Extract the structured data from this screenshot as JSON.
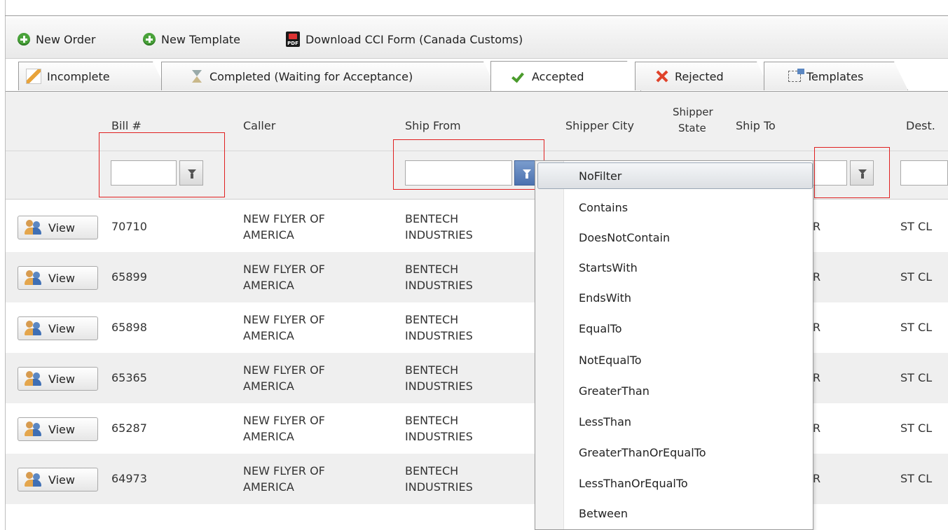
{
  "toolbar": {
    "new_order": "New Order",
    "new_template": "New Template",
    "download_cci": "Download CCI Form (Canada Customs)"
  },
  "tabs": [
    {
      "label": "Incomplete",
      "icon": "pencil-icon"
    },
    {
      "label": "Completed (Waiting for Acceptance)",
      "icon": "hourglass-icon"
    },
    {
      "label": "Accepted",
      "icon": "checkmark-icon",
      "active": true
    },
    {
      "label": "Rejected",
      "icon": "x-icon"
    },
    {
      "label": "Templates",
      "icon": "templates-icon"
    }
  ],
  "columns": {
    "bill": "Bill #",
    "caller": "Caller",
    "ship_from": "Ship From",
    "shipper_city": "Shipper City",
    "shipper_state_1": "Shipper",
    "shipper_state_2": "State",
    "ship_to": "Ship To",
    "dest": "Dest."
  },
  "rows": [
    {
      "view": "View",
      "bill": "70710",
      "caller_1": "NEW FLYER OF",
      "caller_2": "AMERICA",
      "from_1": "BENTECH",
      "from_2": "INDUSTRIES",
      "ship_to": "R",
      "dest": "ST CL"
    },
    {
      "view": "View",
      "bill": "65899",
      "caller_1": "NEW FLYER OF",
      "caller_2": "AMERICA",
      "from_1": "BENTECH",
      "from_2": "INDUSTRIES",
      "ship_to": "R",
      "dest": "ST CL"
    },
    {
      "view": "View",
      "bill": "65898",
      "caller_1": "NEW FLYER OF",
      "caller_2": "AMERICA",
      "from_1": "BENTECH",
      "from_2": "INDUSTRIES",
      "ship_to": "R",
      "dest": "ST CL"
    },
    {
      "view": "View",
      "bill": "65365",
      "caller_1": "NEW FLYER OF",
      "caller_2": "AMERICA",
      "from_1": "BENTECH",
      "from_2": "INDUSTRIES",
      "ship_to": "R",
      "dest": "ST CL"
    },
    {
      "view": "View",
      "bill": "65287",
      "caller_1": "NEW FLYER OF",
      "caller_2": "AMERICA",
      "from_1": "BENTECH",
      "from_2": "INDUSTRIES",
      "ship_to": "R",
      "dest": "ST CL"
    },
    {
      "view": "View",
      "bill": "64973",
      "caller_1": "NEW FLYER OF",
      "caller_2": "AMERICA",
      "from_1": "BENTECH",
      "from_2": "INDUSTRIES",
      "ship_to": "R",
      "dest": "ST CL"
    }
  ],
  "filter_menu": {
    "selected": "NoFilter",
    "options": [
      "NoFilter",
      "Contains",
      "DoesNotContain",
      "StartsWith",
      "EndsWith",
      "EqualTo",
      "NotEqualTo",
      "GreaterThan",
      "LessThan",
      "GreaterThanOrEqualTo",
      "LessThanOrEqualTo",
      "Between"
    ]
  },
  "filters": {
    "bill_value": "",
    "ship_from_value": "",
    "ship_to_value": "",
    "dest_value": ""
  },
  "colors": {
    "highlight": "#e02020",
    "active_filter": "#4c72b0",
    "row_alt": "#efefef",
    "header_bg": "#f0f0f0"
  }
}
